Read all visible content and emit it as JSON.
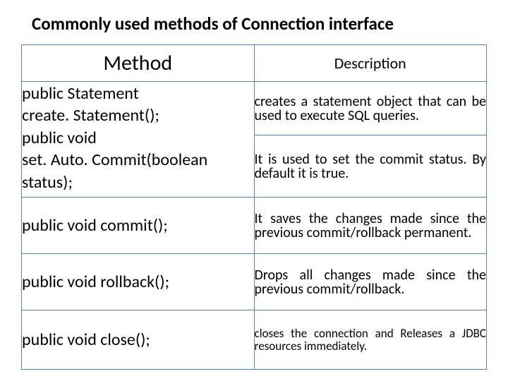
{
  "title": "Commonly used methods of Connection interface",
  "headers": {
    "method": "Method",
    "description": "Description"
  },
  "rows": {
    "r1": {
      "method_line1": "public Statement",
      "method_line2": "create. Statement();",
      "method_line3": "public void",
      "method_line4": "set. Auto. Commit(boolean",
      "method_line5": "status);",
      "desc1": "creates a statement object that can be used to execute SQL queries.",
      "desc2": "It is used to set the commit status. By default it is true."
    },
    "r2": {
      "method": "public void commit();",
      "desc": "It saves the changes made since the previous commit/rollback permanent."
    },
    "r3": {
      "method": "public void rollback();",
      "desc": "Drops all changes made since the previous commit/rollback."
    },
    "r4": {
      "method": "public void close();",
      "desc": "closes the connection and Releases a JDBC resources immediately."
    }
  }
}
